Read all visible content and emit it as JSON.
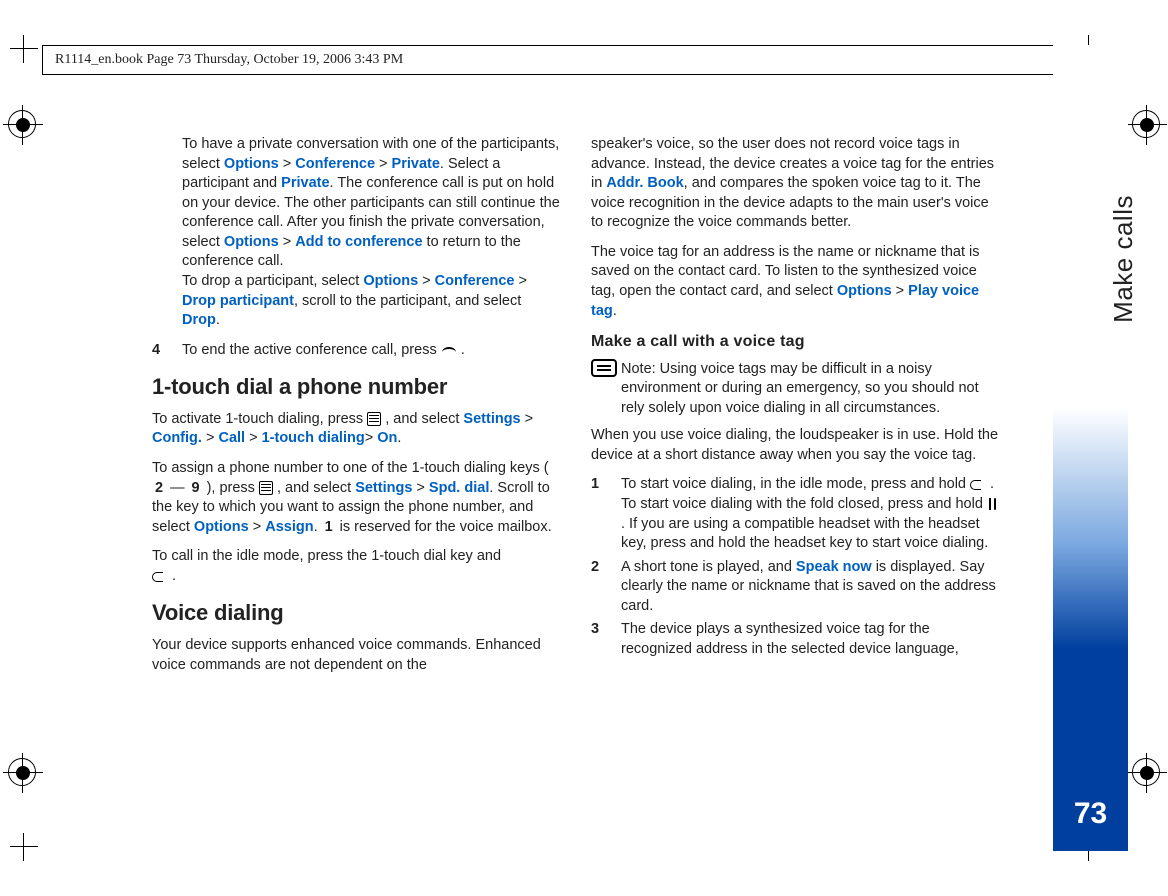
{
  "header": {
    "line": "R1114_en.book  Page 73  Thursday, October 19, 2006  3:43 PM"
  },
  "side": {
    "label": "Make calls",
    "page": "73"
  },
  "left": {
    "p1_a": "To have a private conversation with one of the participants, select ",
    "options": "Options",
    "gt": " > ",
    "conference": "Conference",
    "private": "Private",
    "p1_b": ". Select a participant and ",
    "p1_c": ". The conference call is put on hold on your device. The other participants can still continue the conference call. After you finish the private conversation, select ",
    "add_conf": "Add to conference",
    "p1_d": " to return to the conference call.",
    "p1_e": "To drop a participant, select ",
    "drop_part": "Drop participant",
    "p1_f": ", scroll to the participant, and select ",
    "drop": "Drop",
    "period": ".",
    "step4_a": "To end the active conference call, press ",
    "h_onetouch": "1-touch dial a phone number",
    "p2_a": "To activate 1-touch dialing, press ",
    "p2_b": ", and select ",
    "settings": "Settings",
    "config": "Config.",
    "call": "Call",
    "onetouch": "1-touch dialing",
    "on": "On",
    "p3_a": "To assign a phone number to one of the 1-touch dialing keys (",
    "dash": " — ",
    "p3_b": "), press ",
    "p3_c": ", and select ",
    "spddial": "Spd. dial",
    "p3_d": ". Scroll to the key to which you want to assign the phone number, and select ",
    "assign": "Assign",
    "p3_e": ". ",
    "p3_f": " is reserved for the voice mailbox.",
    "p4_a": "To call in the idle mode, press the 1-touch dial key and ",
    "h_voice": "Voice dialing",
    "p5": "Your device supports enhanced voice commands. Enhanced voice commands are not dependent on the ",
    "num4": "4",
    "d2": "2",
    "d9": "9",
    "d1": "1"
  },
  "right": {
    "p1_a": "speaker's voice, so the user does not record voice tags in advance. Instead, the device creates a voice tag for the entries in ",
    "addrbook": "Addr. Book",
    "p1_b": ", and compares the spoken voice tag to it. The voice recognition in the device adapts to the main user's voice to recognize the voice commands better.",
    "p2_a": "The voice tag for an address is the name or nickname that is saved on the contact card. To listen to the synthesized voice tag, open the contact card, and select ",
    "options": "Options",
    "gt": " > ",
    "playtag": "Play voice tag",
    "period": ".",
    "h_sub": "Make a call with a voice tag",
    "note_a": "Note: Using voice tags may be difficult in a noisy environment or during an emergency, so you should not rely solely upon voice dialing in all circumstances.",
    "p3": "When you use voice dialing, the loudspeaker is in use. Hold the device at a short distance away when you say the voice tag.",
    "s1_a": "To start voice dialing, in the idle mode, press and hold ",
    "s1_b": ". To start voice dialing with the fold closed, press and hold ",
    "s1_c": ". If you are using a compatible headset with the headset key, press and hold the headset key to start voice dialing.",
    "s2_a": "A short tone is played, and ",
    "speaknow": "Speak now",
    "s2_b": " is displayed. Say clearly the name or nickname that is saved on the address card.",
    "s3": "The device plays a synthesized voice tag for the recognized address in the selected device language, ",
    "n1": "1",
    "n2": "2",
    "n3": "3"
  }
}
